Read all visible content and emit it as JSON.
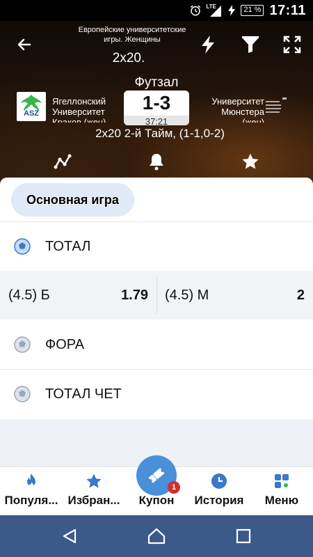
{
  "status_bar": {
    "time": "17:11",
    "battery": "21 %",
    "network": "LTE"
  },
  "header": {
    "tournament_line1": "Европейские университетские",
    "tournament_line2": "игры. Женщины",
    "period_short": "2х20.",
    "sport": "Футзал",
    "home_line1": "Ягеллонский",
    "home_line2": "Университет",
    "home_line3": "Краков (жен)",
    "away_line1": "Университет",
    "away_line2": "Мюнстера",
    "away_line3": "(жен)",
    "score": "1-3",
    "clock": "37:21",
    "period_full": "2х20 2-й Тайм, (1-1,0-2)"
  },
  "main": {
    "chip_label": "Основная игра",
    "markets": [
      {
        "title": "ТОТАЛ"
      },
      {
        "title": "ФОРА"
      },
      {
        "title": "ТОТАЛ ЧЕТ"
      }
    ],
    "total_odds": {
      "left_label": "(4.5) Б",
      "left_value": "1.79",
      "right_label": "(4.5) М",
      "right_value": "2"
    }
  },
  "bottom_nav": {
    "items": [
      {
        "label": "Популя..."
      },
      {
        "label": "Избран..."
      },
      {
        "label": "Купон"
      },
      {
        "label": "История"
      },
      {
        "label": "Меню"
      }
    ],
    "coupon_badge": "1"
  },
  "colors": {
    "accent": "#4a8fd9",
    "badge": "#d32f2f",
    "system_nav": "#3b5a8a"
  },
  "icons": [
    "back-arrow-icon",
    "lightning-icon",
    "filter-icon",
    "expand-icon",
    "stats-icon",
    "bell-icon",
    "star-icon",
    "ball-icon",
    "flame-icon",
    "ticket-icon",
    "clock-icon",
    "menu-grid-icon"
  ]
}
